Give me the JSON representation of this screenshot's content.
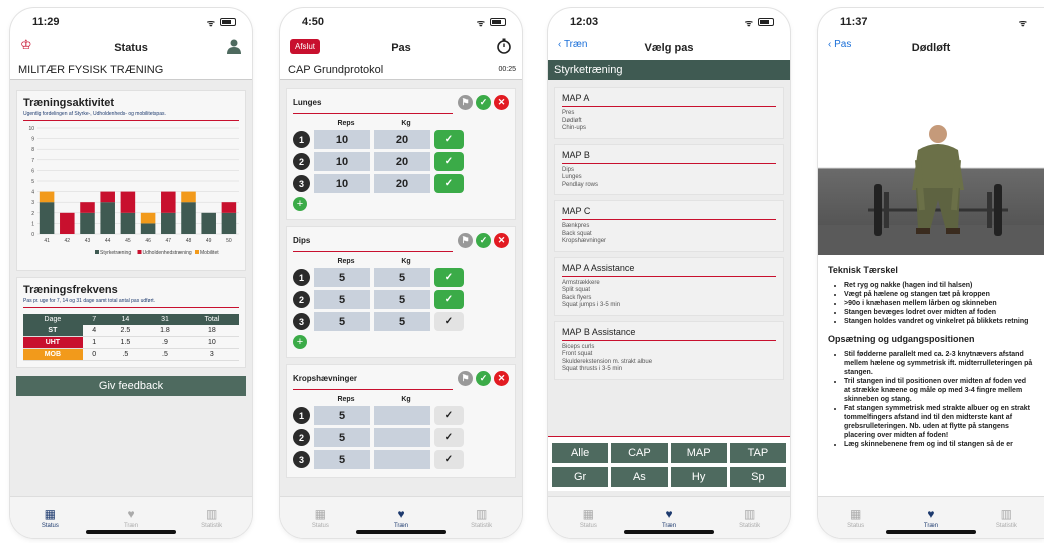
{
  "colors": {
    "dark_green": "#3f5a52",
    "button_green": "#4e6a5f",
    "red": "#c8102e",
    "orange": "#f29a1b",
    "check_green": "#3bab48",
    "ios_blue": "#1a6fd8"
  },
  "phone1": {
    "time": "11:29",
    "nav_title": "Status",
    "section_title": "MILITÆR FYSISK TRÆNING",
    "activity": {
      "title": "Træningsaktivitet",
      "subtitle": "Ugentlig fordelingen af Styrke-, Udholdenheds- og mobilitetspas."
    },
    "chart_data": {
      "type": "bar",
      "stacked": true,
      "categories": [
        "41",
        "42",
        "43",
        "44",
        "45",
        "46",
        "47",
        "48",
        "49",
        "50"
      ],
      "series": [
        {
          "name": "Styrketræning",
          "color": "#3f5a52",
          "values": [
            3,
            0,
            2,
            3,
            2,
            1,
            2,
            3,
            2,
            2
          ]
        },
        {
          "name": "Udholdenhedstræning",
          "color": "#c8102e",
          "values": [
            0,
            2,
            1,
            1,
            2,
            0,
            2,
            0,
            0,
            1
          ]
        },
        {
          "name": "Mobilitet",
          "color": "#f29a1b",
          "values": [
            1,
            0,
            0,
            0,
            0,
            1,
            0,
            1,
            0,
            0
          ]
        }
      ],
      "ylim": [
        0,
        10
      ],
      "yticks": [
        "0",
        "1",
        "2",
        "3",
        "4",
        "5",
        "6",
        "7",
        "8",
        "9",
        "10"
      ],
      "grid": true,
      "legend": "bottom-right"
    },
    "frequency": {
      "title": "Træningsfrekvens",
      "subtitle": "Pas pr. uge for 7, 14 og 31 dage samt total antal pas udført.",
      "headers": [
        "Dage",
        "7",
        "14",
        "31",
        "Total"
      ],
      "rows": [
        {
          "label": "ST",
          "color": "#3f5a52",
          "values": [
            "4",
            "2.5",
            "1.8",
            "18"
          ]
        },
        {
          "label": "UHT",
          "color": "#c8102e",
          "values": [
            "1",
            "1.5",
            ".9",
            "10"
          ]
        },
        {
          "label": "MOB",
          "color": "#f29a1b",
          "values": [
            "0",
            ".5",
            ".5",
            "3"
          ]
        }
      ]
    },
    "feedback_button": "Giv feedback",
    "tabs": [
      "Status",
      "Træn",
      "Statistik"
    ]
  },
  "phone2": {
    "time": "4:50",
    "nav_left": "Afslut",
    "nav_title": "Pas",
    "section_title": "CAP Grundprotokol",
    "timer": "00:25",
    "col_reps": "Reps",
    "col_kg": "Kg",
    "exercises": [
      {
        "name": "Lunges",
        "sets": [
          {
            "n": "1",
            "reps": "10",
            "kg": "20",
            "done": true
          },
          {
            "n": "2",
            "reps": "10",
            "kg": "20",
            "done": true
          },
          {
            "n": "3",
            "reps": "10",
            "kg": "20",
            "done": true
          }
        ]
      },
      {
        "name": "Dips",
        "sets": [
          {
            "n": "1",
            "reps": "5",
            "kg": "5",
            "done": true
          },
          {
            "n": "2",
            "reps": "5",
            "kg": "5",
            "done": true
          },
          {
            "n": "3",
            "reps": "5",
            "kg": "5",
            "done": false
          }
        ]
      },
      {
        "name": "Kropshævninger",
        "sets": [
          {
            "n": "1",
            "reps": "5",
            "kg": "",
            "done": false
          },
          {
            "n": "2",
            "reps": "5",
            "kg": "",
            "done": false
          },
          {
            "n": "3",
            "reps": "5",
            "kg": "",
            "done": false
          }
        ]
      }
    ],
    "tabs": [
      "Status",
      "Træn",
      "Statistik"
    ]
  },
  "phone3": {
    "time": "12:03",
    "nav_back": "Træn",
    "nav_title": "Vælg pas",
    "category": "Styrketræning",
    "pas": [
      {
        "title": "MAP A",
        "items": [
          "Pres",
          "Dødløft",
          "Chin-ups"
        ]
      },
      {
        "title": "MAP B",
        "items": [
          "Dips",
          "Lunges",
          "Pendlay rows"
        ]
      },
      {
        "title": "MAP C",
        "items": [
          "Bænkpres",
          "Back squat",
          "Kropshævninger"
        ]
      },
      {
        "title": "MAP A Assistance",
        "items": [
          "Armstrækkere",
          "Split squat",
          "Back flyers",
          "Squat jumps i 3-5 min"
        ]
      },
      {
        "title": "MAP B Assistance",
        "items": [
          "Biceps curls",
          "Front squat",
          "Skulderekstension m. strakt albue",
          "Squat thrusts i 3-5 min"
        ]
      }
    ],
    "filters_row1": [
      "Alle",
      "CAP",
      "MAP",
      "TAP"
    ],
    "filters_row2": [
      "Gr",
      "As",
      "Hy",
      "Sp"
    ],
    "tabs": [
      "Status",
      "Træn",
      "Statistik"
    ]
  },
  "phone4": {
    "time": "11:37",
    "nav_back": "Pas",
    "nav_title": "Dødløft",
    "heading1": "Teknisk Tærskel",
    "bullets1": [
      "Ret ryg og nakke (hagen ind til halsen)",
      "Vægt på hælene og stangen tæt på kroppen",
      ">90o i knæhasen mellem lårben og skinneben",
      "Stangen bevæges lodret over midten af foden",
      "Stangen holdes vandret og vinkelret på blikkets retning"
    ],
    "heading2": "Opsætning og udgangspositionen",
    "bullets2": [
      "Stil fødderne parallelt med ca. 2-3 knytnævers afstand mellem hælene og symmetrisk ift. midterrulleteringen på stangen.",
      "Tril stangen ind til positionen over midten af foden ved at strække knæene og måle op med 3-4 fingre mellem skinneben og stang.",
      "Fat stangen symmetrisk med strakte albuer og en strakt tommelfingers afstand ind til den midterste kant af grebsrulleteringen. Nb. uden at flytte på stangens placering over midten af foden!",
      "Læg skinnebenene frem og ind til stangen så de er"
    ],
    "tabs": [
      "Status",
      "Træn",
      "Statistik"
    ]
  }
}
